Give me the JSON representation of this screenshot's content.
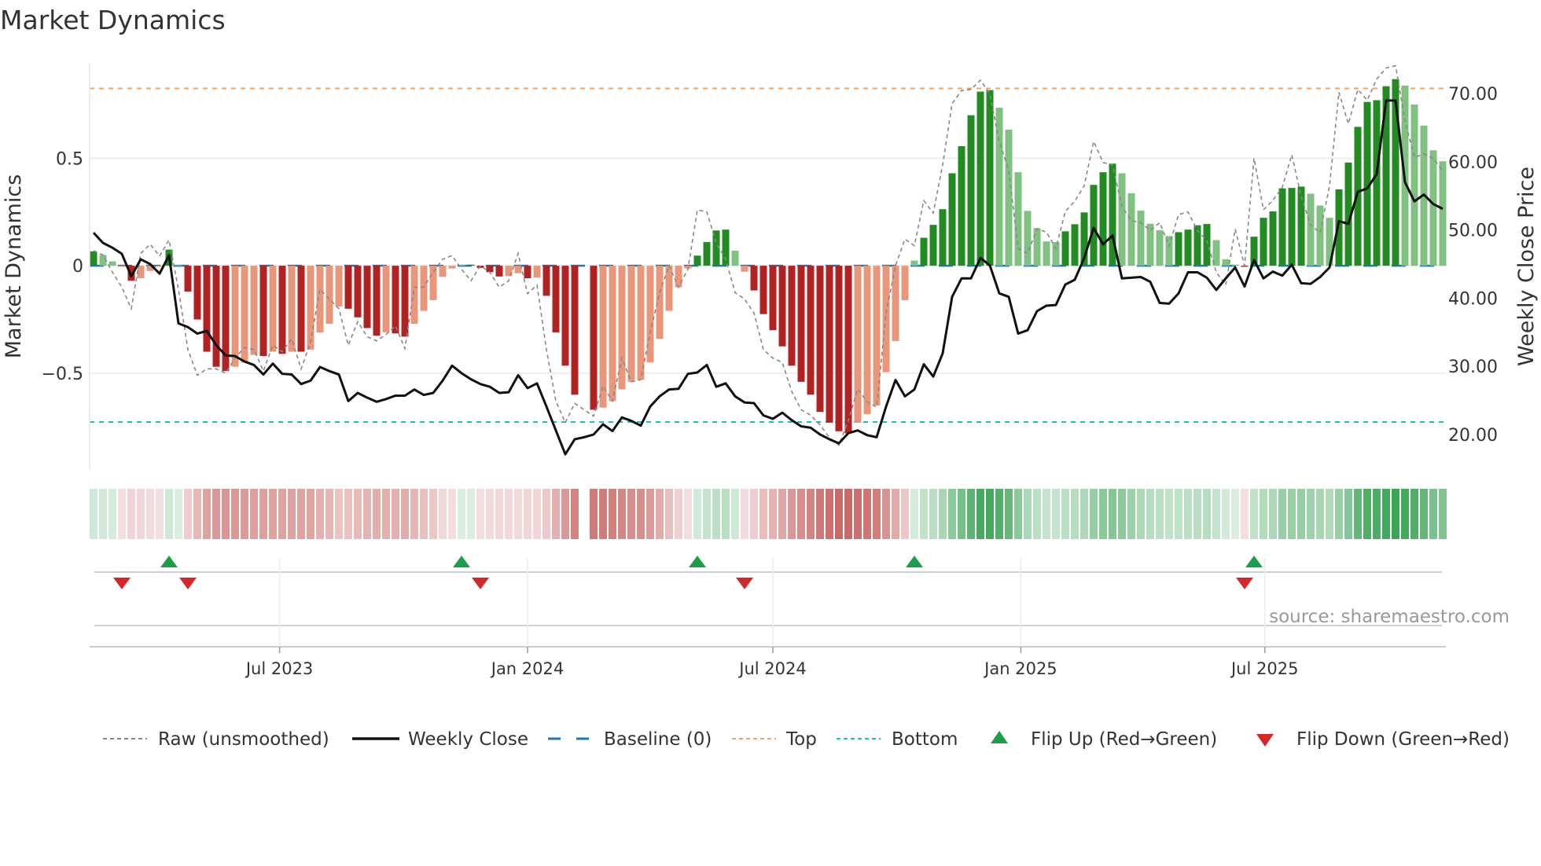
{
  "title": "Market Dynamics",
  "source": "source: sharemaestro.com",
  "colors": {
    "bar_pos_strong": "#228b22",
    "bar_pos_weak": "#80c080",
    "bar_neg_strong": "#b22222",
    "bar_neg_weak": "#e9967a",
    "close": "#111111",
    "raw": "#888888",
    "baseline": "#1f77b4",
    "top": "#f4a460",
    "bottom": "#17becf",
    "flip_up": "#1a9e4a",
    "flip_down": "#d62728",
    "heat_pos": "#2e9e4a",
    "heat_neg": "#c0504d"
  },
  "legend": [
    {
      "key": "raw",
      "label": "Raw (unsmoothed)"
    },
    {
      "key": "close",
      "label": "Weekly Close"
    },
    {
      "key": "baseline",
      "label": "Baseline (0)"
    },
    {
      "key": "top",
      "label": "Top"
    },
    {
      "key": "bottom",
      "label": "Bottom"
    },
    {
      "key": "flip_up",
      "label": "Flip Up (Red→Green)"
    },
    {
      "key": "flip_down",
      "label": "Flip Down (Green→Red)"
    }
  ],
  "chart_data": {
    "type": "bar",
    "title": "Market Dynamics",
    "ylabel": "Market Dynamics",
    "y2label": "Weekly Close Price",
    "ylim": [
      -0.95,
      0.94
    ],
    "y2lim": [
      14.8,
      74.4
    ],
    "yticks": [
      {
        "v": 0.5,
        "label": "0.5"
      },
      {
        "v": 0,
        "label": "0"
      },
      {
        "v": -0.5,
        "label": "−0.5"
      }
    ],
    "y2ticks": [
      {
        "v": 70,
        "label": "70.00"
      },
      {
        "v": 60,
        "label": "60.00"
      },
      {
        "v": 50,
        "label": "50.00"
      },
      {
        "v": 40,
        "label": "40.00"
      },
      {
        "v": 30,
        "label": "30.00"
      },
      {
        "v": 20,
        "label": "20.00"
      }
    ],
    "start_date": "2023-02-13",
    "frequency": "weekly",
    "xticks": [
      {
        "date": "2023-07-01",
        "label": "Jul 2023"
      },
      {
        "date": "2024-01-01",
        "label": "Jan 2024"
      },
      {
        "date": "2024-07-01",
        "label": "Jul 2024"
      },
      {
        "date": "2025-01-01",
        "label": "Jan 2025"
      },
      {
        "date": "2025-07-01",
        "label": "Jul 2025"
      }
    ],
    "top_level": 0.825,
    "bottom_level": -0.727,
    "baseline": 0,
    "smoothed": [
      0.067,
      0.05,
      0.02,
      -0.005,
      -0.07,
      -0.058,
      -0.024,
      -0.005,
      0.075,
      0.005,
      -0.12,
      -0.25,
      -0.4,
      -0.47,
      -0.49,
      -0.47,
      -0.45,
      -0.415,
      -0.42,
      -0.4,
      -0.41,
      -0.4,
      -0.4,
      -0.39,
      -0.31,
      -0.27,
      -0.19,
      -0.2,
      -0.24,
      -0.29,
      -0.325,
      -0.31,
      -0.315,
      -0.33,
      -0.27,
      -0.21,
      -0.16,
      -0.052,
      -0.013,
      0.005,
      0.005,
      -0.01,
      -0.03,
      -0.05,
      -0.048,
      -0.035,
      -0.058,
      -0.055,
      -0.14,
      -0.31,
      -0.465,
      -0.6,
      null,
      -0.67,
      -0.66,
      -0.63,
      -0.575,
      -0.54,
      -0.53,
      -0.45,
      -0.34,
      -0.21,
      -0.1,
      -0.013,
      0.047,
      0.11,
      0.164,
      0.168,
      0.07,
      -0.028,
      -0.115,
      -0.225,
      -0.3,
      -0.375,
      -0.465,
      -0.54,
      -0.6,
      -0.68,
      -0.73,
      -0.77,
      -0.78,
      -0.73,
      -0.69,
      -0.65,
      -0.495,
      -0.35,
      -0.16,
      0.024,
      0.13,
      0.19,
      0.263,
      0.43,
      0.556,
      0.7,
      0.81,
      0.817,
      0.735,
      0.633,
      0.435,
      0.255,
      0.175,
      0.113,
      0.11,
      0.16,
      0.193,
      0.248,
      0.376,
      0.435,
      0.475,
      0.43,
      0.337,
      0.256,
      0.195,
      0.165,
      0.138,
      0.156,
      0.168,
      0.188,
      0.194,
      0.119,
      0.03,
      0.005,
      -0.005,
      0.135,
      0.223,
      0.253,
      0.36,
      0.362,
      0.368,
      0.335,
      0.28,
      0.223,
      0.355,
      0.48,
      0.646,
      0.762,
      0.77,
      0.835,
      0.868,
      0.838,
      0.75,
      0.652,
      0.537,
      0.486
    ],
    "raw": [
      0.07,
      0.05,
      -0.03,
      -0.1,
      -0.2,
      0.057,
      0.1,
      0.045,
      0.12,
      -0.11,
      -0.39,
      -0.51,
      -0.48,
      -0.48,
      -0.5,
      -0.43,
      -0.38,
      -0.39,
      -0.49,
      -0.37,
      -0.4,
      -0.34,
      -0.48,
      -0.355,
      -0.11,
      -0.155,
      -0.2,
      -0.37,
      -0.26,
      -0.33,
      -0.35,
      -0.32,
      -0.28,
      -0.385,
      -0.1,
      -0.1,
      -0.03,
      0.03,
      0.047,
      -0.016,
      -0.07,
      0,
      -0.03,
      -0.1,
      -0.07,
      0.057,
      -0.13,
      -0.09,
      -0.39,
      -0.63,
      -0.73,
      -0.64,
      -0.67,
      -0.7,
      -0.56,
      -0.63,
      -0.43,
      -0.54,
      -0.53,
      -0.31,
      -0.125,
      0,
      -0.1,
      -0.016,
      0.26,
      0.25,
      0.105,
      0.03,
      -0.125,
      -0.155,
      -0.22,
      -0.39,
      -0.43,
      -0.45,
      -0.585,
      -0.67,
      -0.695,
      -0.74,
      -0.8,
      -0.835,
      -0.72,
      -0.573,
      -0.634,
      -0.658,
      -0.22,
      0,
      0.124,
      0.093,
      0.303,
      0.245,
      0.47,
      0.754,
      0.815,
      0.82,
      0.863,
      0.8,
      0.578,
      0.445,
      0.08,
      0.057,
      0.172,
      0.156,
      0.08,
      0.253,
      0.3,
      0.372,
      0.578,
      0.48,
      0.47,
      0.275,
      0.21,
      0.2,
      0.165,
      0.2,
      0.092,
      0.238,
      0.25,
      0.165,
      0.116,
      -0.03,
      -0.09,
      0.17,
      0,
      0.5,
      0.26,
      0.304,
      0.365,
      0.516,
      0.322,
      0.19,
      0.153,
      0.37,
      0.807,
      0.66,
      0.82,
      0.77,
      0.868,
      0.92,
      0.93,
      0.674,
      0.504,
      0.52,
      0.5,
      0.44
    ],
    "close": [
      49.6,
      48.1,
      47.4,
      46.5,
      43.2,
      45.7,
      45.0,
      43.6,
      46.3,
      36.3,
      35.75,
      34.8,
      35.2,
      33.1,
      31.6,
      31.5,
      30.7,
      30.2,
      28.8,
      30.4,
      28.9,
      28.8,
      27.4,
      27.9,
      29.9,
      29.3,
      28.8,
      24.9,
      26.1,
      25.4,
      24.8,
      25.2,
      25.7,
      25.7,
      26.6,
      25.8,
      26.1,
      27.9,
      30.1,
      29.0,
      28.1,
      27.4,
      27.0,
      26.1,
      26.2,
      28.7,
      26.8,
      27.5,
      24.1,
      20.6,
      17.1,
      19.3,
      19.6,
      20.0,
      21.5,
      20.5,
      22.5,
      22.0,
      21.3,
      24.1,
      25.6,
      26.6,
      26.7,
      28.9,
      29.1,
      30.2,
      27.0,
      27.5,
      25.6,
      24.7,
      24.6,
      22.8,
      22.3,
      23.2,
      22.1,
      21.2,
      21.0,
      20.0,
      19.3,
      18.7,
      20.2,
      20.6,
      19.9,
      19.6,
      24.1,
      28.0,
      25.6,
      26.6,
      30.3,
      28.5,
      31.9,
      40.2,
      42.9,
      42.9,
      45.9,
      44.8,
      40.7,
      40.2,
      34.8,
      35.3,
      38.1,
      38.9,
      39.0,
      42.0,
      42.7,
      45.9,
      50.3,
      47.9,
      49.2,
      42.9,
      43.0,
      43.1,
      42.4,
      39.3,
      39.2,
      40.7,
      43.8,
      43.8,
      43.0,
      41.2,
      42.9,
      44.5,
      41.7,
      45.6,
      42.9,
      43.9,
      43.3,
      44.9,
      42.2,
      42.1,
      43.1,
      44.5,
      51.3,
      50.9,
      55.6,
      56.1,
      58.2,
      69.0,
      69.0,
      57.0,
      54.2,
      55.2,
      53.8,
      53.1
    ],
    "flip_up_weeks": [
      9,
      40,
      65,
      88,
      124
    ],
    "flip_down_weeks": [
      4,
      11,
      42,
      70,
      123
    ]
  }
}
